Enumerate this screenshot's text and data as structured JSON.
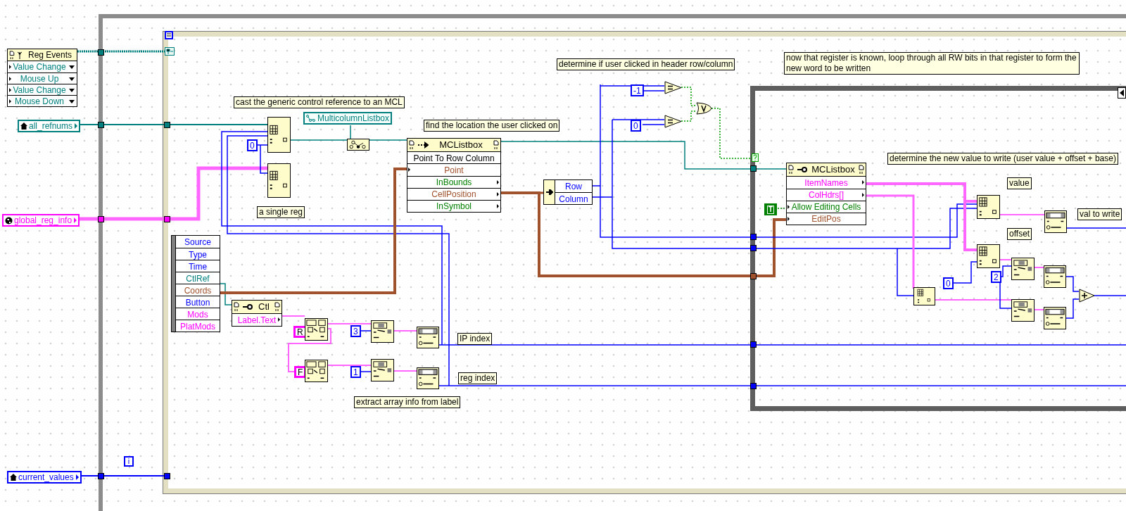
{
  "registration_node": {
    "title": "Reg Events",
    "events": [
      "Value Change",
      "Mouse Up",
      "Value Change",
      "Mouse Down"
    ]
  },
  "terminals": [
    {
      "label": "all_refnums",
      "kind": "local",
      "color": "#007f7f"
    },
    {
      "label": "global_reg_info",
      "kind": "global",
      "color": "#ff00ff"
    },
    {
      "label": "current_values",
      "kind": "local",
      "color": "#0000ff"
    }
  ],
  "iteration_terminal": "i",
  "class_constant": "MulticolumnListbox",
  "invoke_node": {
    "title": "MCListbox",
    "method": "Point To Row Column",
    "rows": [
      {
        "label": "Point",
        "kind": "input",
        "color": "#a0522d"
      },
      {
        "label": "InBounds",
        "kind": "output",
        "color": "#008000"
      },
      {
        "label": "CellPosition",
        "kind": "output",
        "color": "#a0522d"
      },
      {
        "label": "InSymbol",
        "kind": "output",
        "color": "#008000"
      }
    ]
  },
  "unbundle_node": {
    "rows": [
      "Row",
      "Column"
    ]
  },
  "event_data_node": {
    "rows": [
      {
        "label": "Source",
        "color": "#0000ff"
      },
      {
        "label": "Type",
        "color": "#0000ff"
      },
      {
        "label": "Time",
        "color": "#0000ff"
      },
      {
        "label": "CtlRef",
        "color": "#007f7f"
      },
      {
        "label": "Coords",
        "color": "#a0522d"
      },
      {
        "label": "Button",
        "color": "#0000ff"
      },
      {
        "label": "Mods",
        "color": "#ff00ff"
      },
      {
        "label": "PlatMods",
        "color": "#ff00ff"
      }
    ]
  },
  "property_nodes": [
    {
      "title": "Ctl",
      "rows": [
        {
          "label": "Label.Text",
          "kind": "output",
          "color": "#ff00ff"
        }
      ]
    },
    {
      "title": "MCListbox",
      "rows": [
        {
          "label": "ItemNames",
          "kind": "output",
          "color": "#ff00ff"
        },
        {
          "label": "ColHdrs[]",
          "kind": "output",
          "color": "#ff00ff"
        },
        {
          "label": "Allow Editing Cells",
          "kind": "input",
          "color": "#008000"
        },
        {
          "label": "EditPos",
          "kind": "input",
          "color": "#a0522d"
        }
      ]
    }
  ],
  "constants": [
    {
      "value": "0",
      "kind": "numeric"
    },
    {
      "value": "-1",
      "kind": "numeric"
    },
    {
      "value": "0",
      "kind": "numeric"
    },
    {
      "value": "T",
      "kind": "boolean"
    },
    {
      "value": "R",
      "kind": "string"
    },
    {
      "value": "F",
      "kind": "string"
    },
    {
      "value": "3",
      "kind": "numeric"
    },
    {
      "value": "1",
      "kind": "numeric"
    },
    {
      "value": "0",
      "kind": "numeric"
    },
    {
      "value": "2",
      "kind": "numeric"
    }
  ],
  "comments": [
    "cast the generic control reference to an MCL",
    "a single reg",
    "find the location the user clicked on",
    "determine if user clicked in header row/column",
    "now that register is known, loop through all RW bits in that register to form the new word to be written",
    "extract array info from label",
    "determine the new value to write (user value + offset + base)"
  ],
  "wire_labels": [
    "IP index",
    "reg index",
    "value",
    "offset",
    "val to write"
  ]
}
